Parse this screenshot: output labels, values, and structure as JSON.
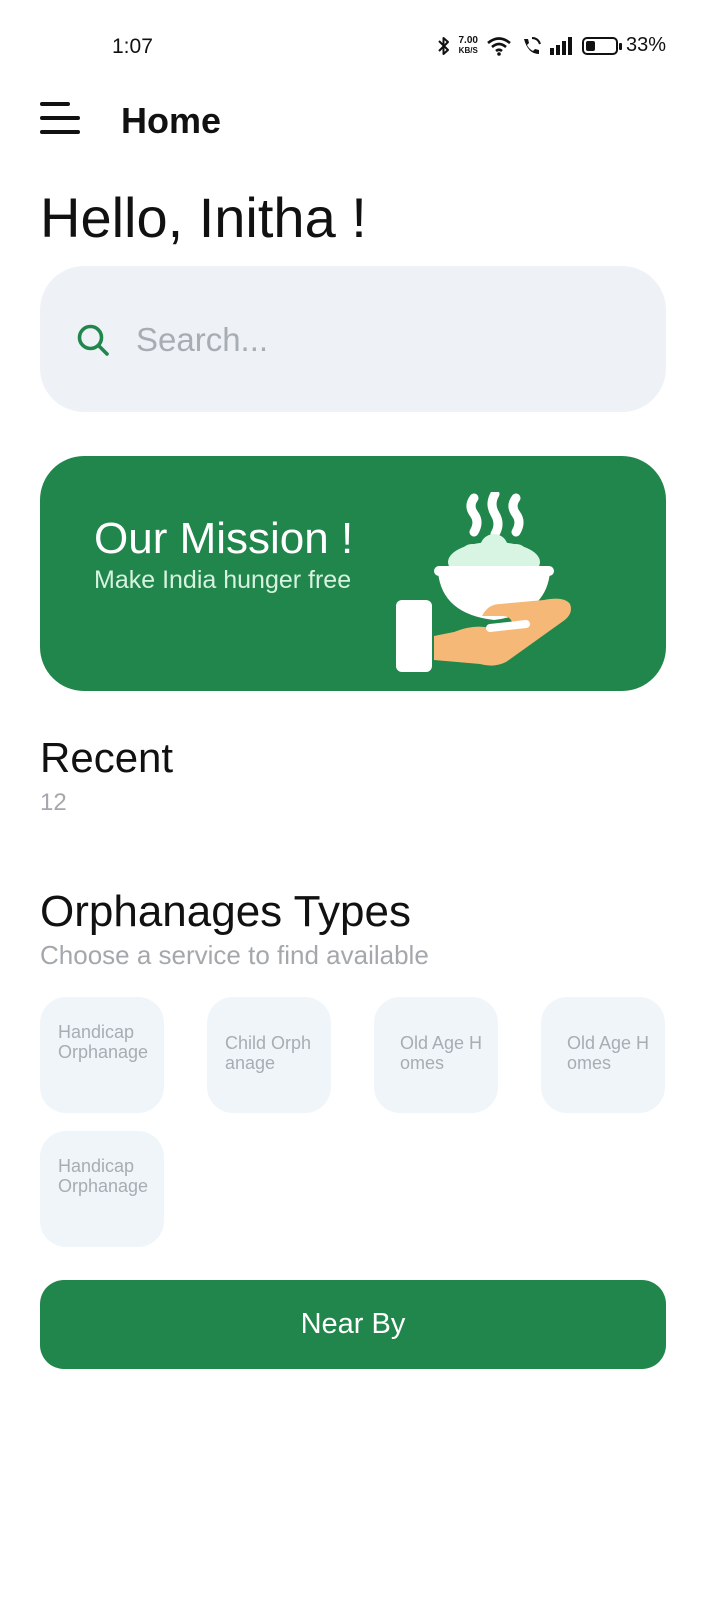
{
  "status_bar": {
    "time": "1:07",
    "net_speed_value": "7.00",
    "net_speed_unit": "KB/S",
    "battery_percent": "33%",
    "battery_level": 0.33
  },
  "app_bar": {
    "title": "Home",
    "menu_icon": "hamburger-menu-icon"
  },
  "greeting": "Hello, Initha !",
  "search": {
    "placeholder": "Search...",
    "value": "",
    "icon": "search-icon"
  },
  "mission": {
    "title": "Our Mission !",
    "subtitle": "Make India hunger free",
    "illustration": "hand-holding-food-bowl-icon"
  },
  "recent": {
    "title": "Recent",
    "count": "12"
  },
  "orphanage_types": {
    "title": "Orphanages Types",
    "subtitle": "Choose a service to find available",
    "items": [
      {
        "label": "Handicap Orphanage"
      },
      {
        "label": "Child Orphanage"
      },
      {
        "label": "Old Age Homes"
      },
      {
        "label": "Old Age Homes"
      },
      {
        "label": "Handicap Orphanage"
      }
    ]
  },
  "nearby_button": "Near By",
  "colors": {
    "primary_green": "#21864b",
    "card_bg": "#f0f5f9",
    "search_bg": "#eef2f6",
    "muted_text": "#a7adb3"
  }
}
